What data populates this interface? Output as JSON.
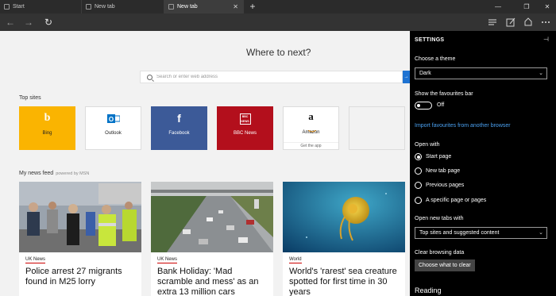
{
  "tabs": [
    {
      "label": "Start",
      "active": false
    },
    {
      "label": "New tab",
      "active": false
    },
    {
      "label": "New tab",
      "active": true
    }
  ],
  "tabbar": {
    "new_tab_symbol": "+",
    "close_symbol": "✕",
    "minimize_symbol": "—",
    "maximize_symbol": "❐",
    "winclose_symbol": "✕"
  },
  "toolbar": {
    "back_symbol": "←",
    "forward_symbol": "→",
    "refresh_symbol": "↻"
  },
  "newtab": {
    "heading": "Where to next?",
    "search_placeholder": "Search or enter web address",
    "go_symbol": "→",
    "top_sites_label": "Top sites",
    "top_sites": [
      {
        "name": "Bing",
        "glyph": "b",
        "color": "#fab401"
      },
      {
        "name": "Outlook",
        "glyph": "O",
        "color": "#0072c6"
      },
      {
        "name": "Facebook",
        "glyph": "f",
        "color": "#3c5a98"
      },
      {
        "name": "BBC News",
        "glyph": "BBC NEWS",
        "color": "#b30f1c"
      },
      {
        "name": "Amazon",
        "glyph": "a",
        "sub": "Get the app"
      },
      {
        "name": ""
      }
    ],
    "feed_label": "My news feed",
    "feed_powered": "powered by MSN",
    "cards": [
      {
        "category": "UK News",
        "headline": "Police arrest 27 migrants found in M25 lorry"
      },
      {
        "category": "UK News",
        "headline": "Bank Holiday: 'Mad scramble and mess' as an extra 13 million cars"
      },
      {
        "category": "World",
        "headline": "World's 'rarest' sea creature spotted for first time in 30 years"
      }
    ]
  },
  "settings": {
    "title": "SETTINGS",
    "pin_symbol": "⊣",
    "theme_label": "Choose a theme",
    "theme_value": "Dark",
    "favbar_label": "Show the favourites bar",
    "favbar_state": "Off",
    "import_link": "Import favourites from another browser",
    "open_with_label": "Open with",
    "open_with_options": [
      {
        "label": "Start page",
        "checked": true
      },
      {
        "label": "New tab page",
        "checked": false
      },
      {
        "label": "Previous pages",
        "checked": false
      },
      {
        "label": "A specific page or pages",
        "checked": false
      }
    ],
    "newtabs_label": "Open new tabs with",
    "newtabs_value": "Top sites and suggested content",
    "clear_label": "Clear browsing data",
    "clear_button": "Choose what to clear",
    "reading_label": "Reading",
    "chevron_symbol": "⌄"
  },
  "colors": {
    "accent": "#1e73d2",
    "link": "#4aa0f0",
    "settings_bg": "#000000",
    "tab_bg": "#2b2b2b"
  }
}
